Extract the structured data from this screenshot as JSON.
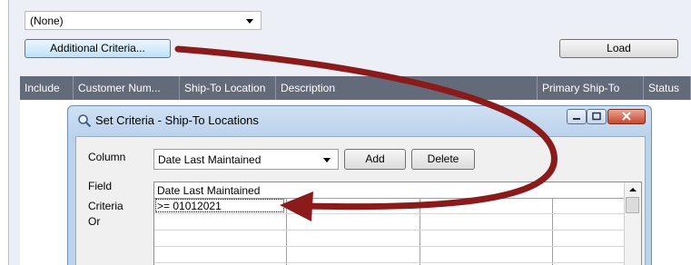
{
  "filter": {
    "selected": "(None)"
  },
  "buttons": {
    "additional_criteria": "Additional Criteria...",
    "load": "Load"
  },
  "grid": {
    "columns": [
      "Include",
      "Customer Num...",
      "Ship-To Location",
      "Description",
      "Primary Ship-To",
      "Status"
    ]
  },
  "dialog": {
    "title": "Set Criteria - Ship-To Locations",
    "column_label": "Column",
    "column_value": "Date Last Maintained",
    "add_label": "Add",
    "delete_label": "Delete",
    "row_labels": {
      "field": "Field",
      "criteria": "Criteria",
      "or": "Or"
    },
    "criteria_grid": {
      "header": [
        "Date Last Maintained",
        "",
        "",
        ""
      ],
      "criteria_row": [
        ">= 01012021",
        "",
        "",
        ""
      ]
    }
  },
  "colors": {
    "arrow": "#8b1a1a",
    "grid_header": "#636b7a",
    "dialog_title_bg": "#c7dbf0"
  },
  "icons": [
    "magnifier-icon",
    "minimize-icon",
    "maximize-icon",
    "close-icon",
    "dropdown-arrow-icon",
    "scroll-up-icon"
  ]
}
